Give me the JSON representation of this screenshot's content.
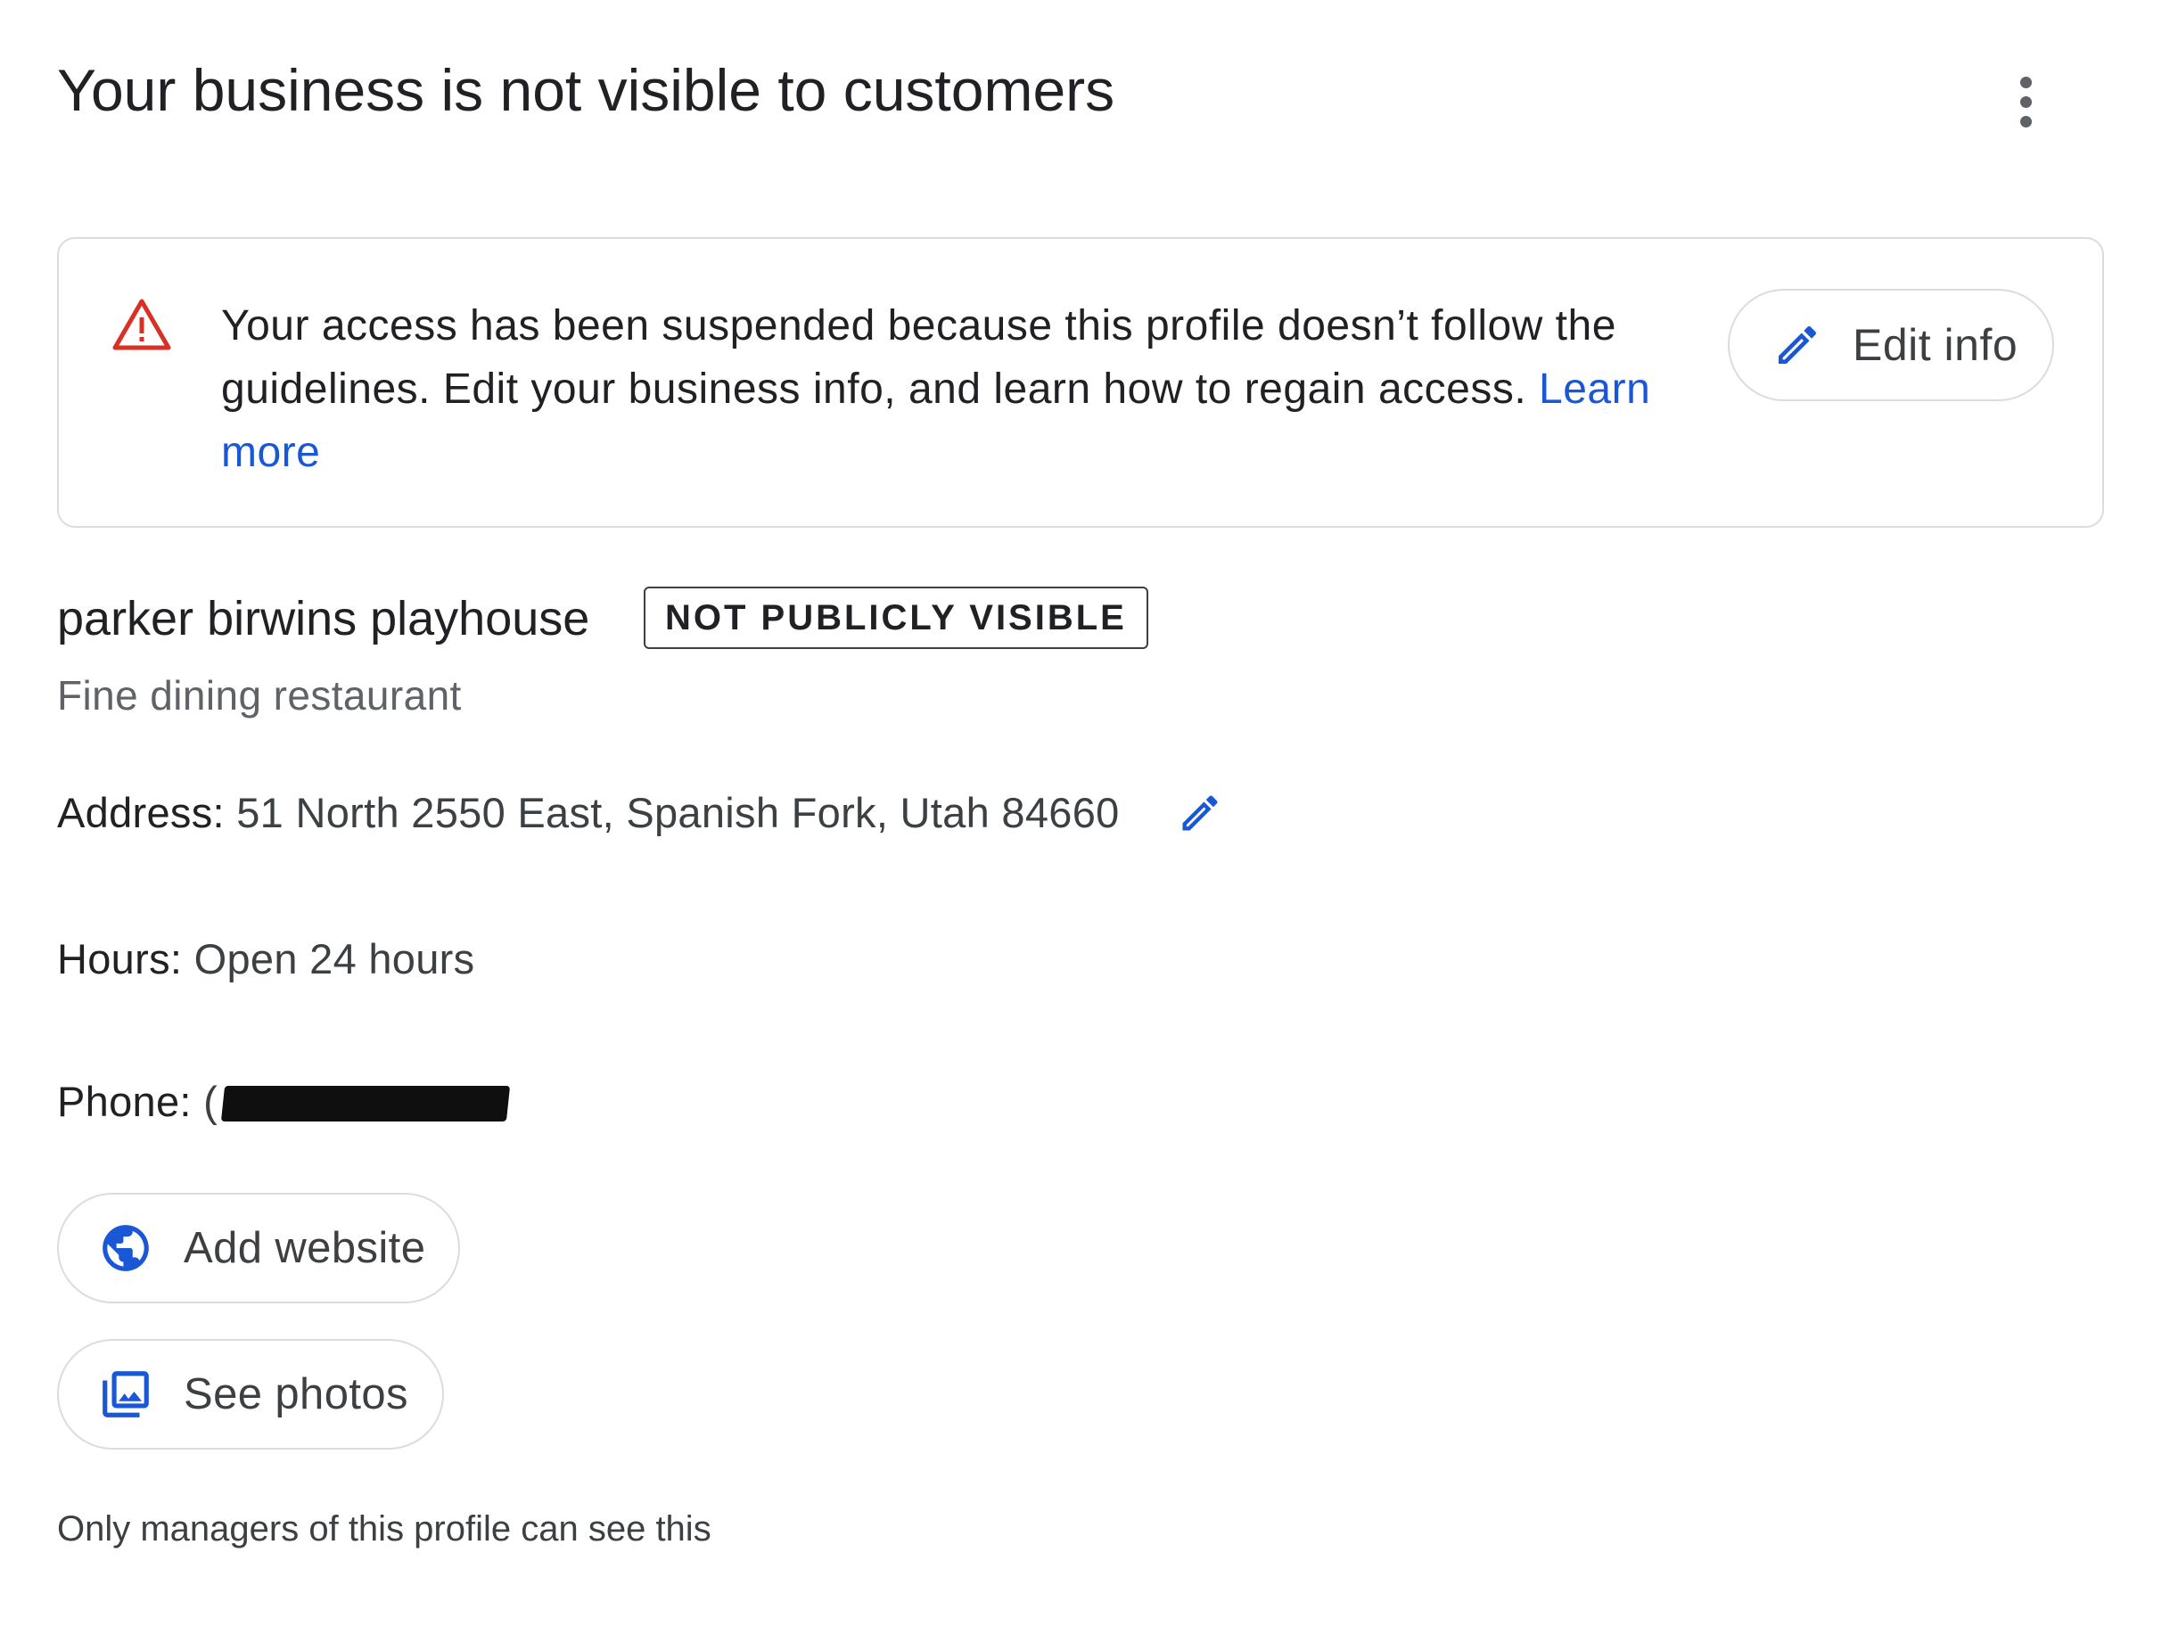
{
  "header": {
    "title": "Your business is not visible to customers",
    "more_icon": "more-vert-icon"
  },
  "alert": {
    "icon": "warning-triangle-icon",
    "message": "Your access has been suspended because this profile doesn’t follow the guidelines. Edit your business info, and learn how to regain access.",
    "link_label": "Learn more",
    "edit_button_label": "Edit info",
    "edit_icon": "pencil-icon",
    "colors": {
      "warning": "#d93025",
      "link": "#1a57d6",
      "border": "#dadce0"
    }
  },
  "business": {
    "name": "parker birwins playhouse",
    "visibility_badge": "NOT PUBLICLY VISIBLE",
    "category": "Fine dining restaurant"
  },
  "details": {
    "address_label": "Address:",
    "address_value": "51 North 2550 East, Spanish Fork, Utah 84660",
    "address_edit_icon": "pencil-icon",
    "hours_label": "Hours:",
    "hours_value": "Open 24 hours",
    "phone_label": "Phone:",
    "phone_value_prefix": "(",
    "phone_redacted": true
  },
  "actions": {
    "add_website_label": "Add website",
    "add_website_icon": "globe-icon",
    "see_photos_label": "See photos",
    "see_photos_icon": "photo-library-icon"
  },
  "footer": {
    "note": "Only managers of this profile can see this"
  }
}
